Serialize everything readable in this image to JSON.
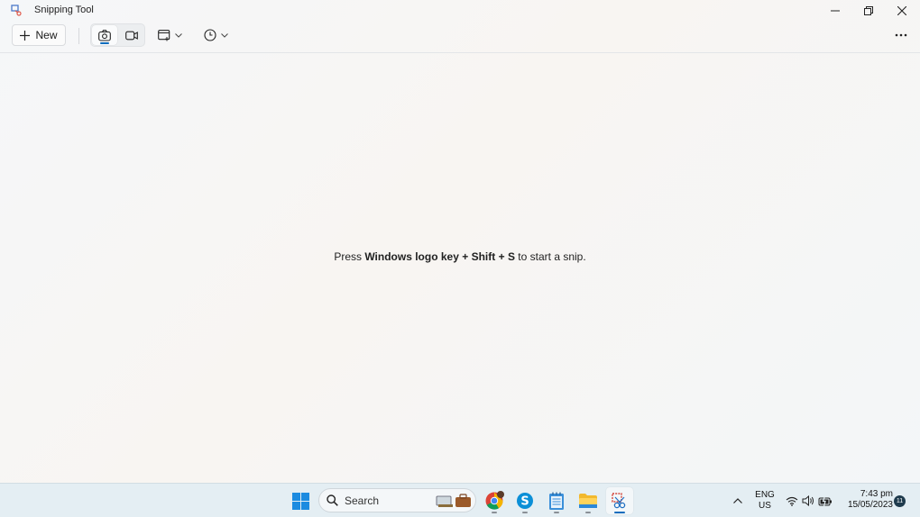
{
  "window": {
    "title": "Snipping Tool"
  },
  "toolbar": {
    "new_label": "New"
  },
  "main": {
    "hint_prefix": "Press ",
    "hint_keys1": "Windows logo key",
    "hint_plus1": " + ",
    "hint_keys2": "Shift",
    "hint_plus2": " + ",
    "hint_keys3": "S",
    "hint_suffix": " to start a snip."
  },
  "taskbar": {
    "search_label": "Search",
    "language_line1": "ENG",
    "language_line2": "US",
    "time": "7:43 pm",
    "date": "15/05/2023",
    "notification_count": "11"
  },
  "colors": {
    "accent": "#0f6cbd",
    "taskbar": "#e4eef3"
  }
}
